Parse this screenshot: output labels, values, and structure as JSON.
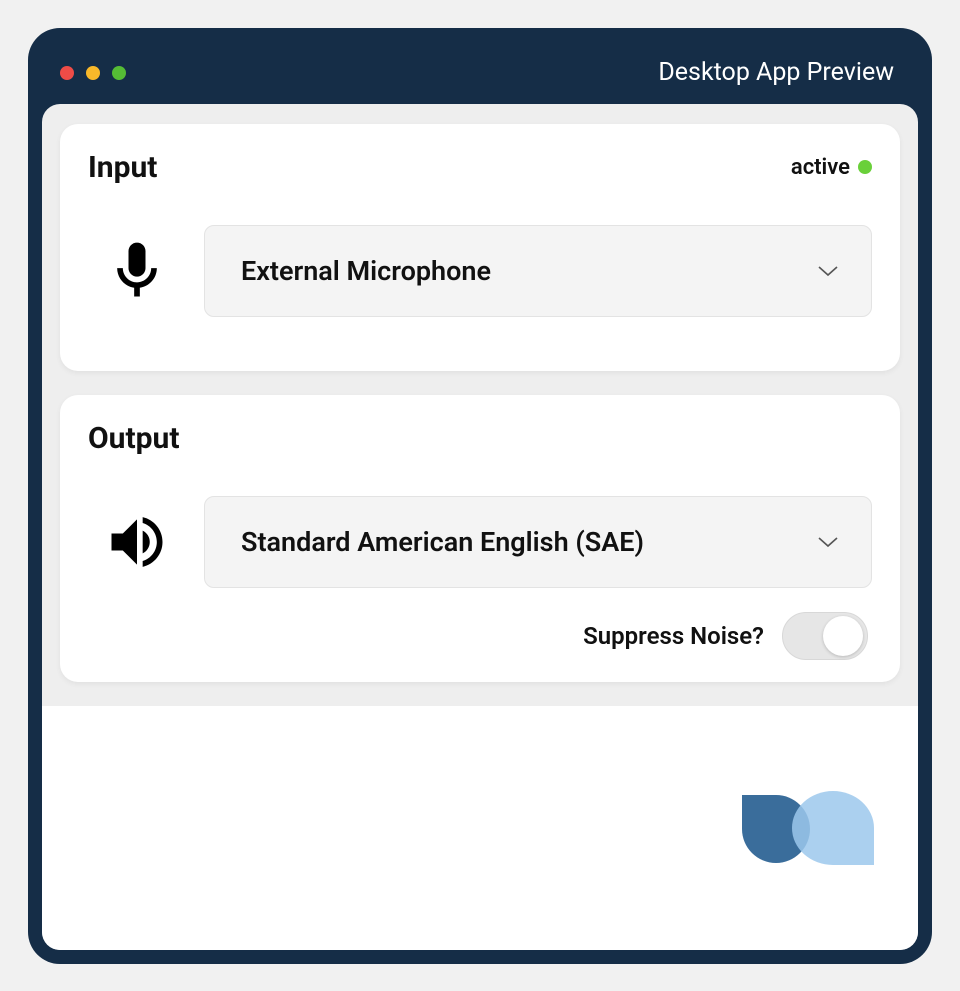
{
  "window": {
    "title": "Desktop App Preview"
  },
  "input_section": {
    "title": "Input",
    "status_label": "active",
    "selected_device": "External Microphone"
  },
  "output_section": {
    "title": "Output",
    "selected_voice": "Standard American English (SAE)",
    "suppress_noise_label": "Suppress Noise?"
  }
}
